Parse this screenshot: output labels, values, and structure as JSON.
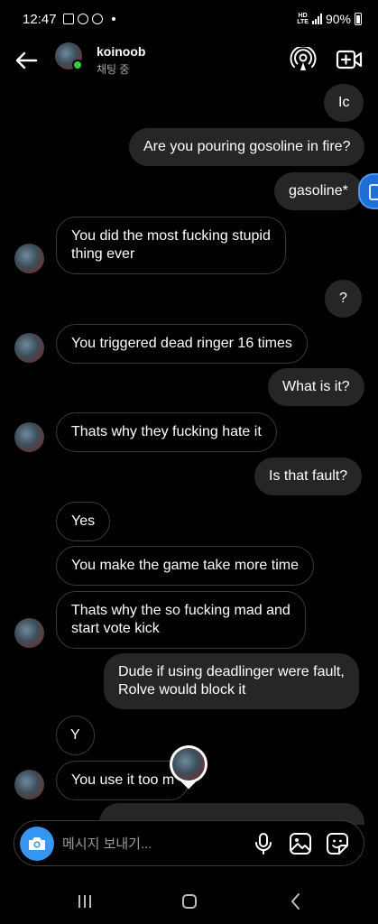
{
  "status_bar": {
    "time": "12:47",
    "network_top": "HD",
    "network_bottom": "LTE",
    "battery": "90%",
    "icons": [
      "gallery-icon",
      "instagram-icon",
      "app-icon",
      "dot"
    ]
  },
  "header": {
    "name": "koinoob",
    "status": "채팅 중",
    "icons": [
      "back-arrow-icon",
      "audio-call-icon",
      "video-call-icon"
    ],
    "online_color": "#2ecc40"
  },
  "messages": [
    {
      "side": "sent",
      "text": "Ic"
    },
    {
      "side": "sent",
      "text": "Are you pouring gosoline in fire?"
    },
    {
      "side": "sent",
      "text": "gasoline*"
    },
    {
      "side": "received",
      "text": "You did the most fucking stupid\nthing ever"
    },
    {
      "side": "sent",
      "text": "?"
    },
    {
      "side": "received",
      "text": "You triggered dead ringer 16 times"
    },
    {
      "side": "sent",
      "text": "What is it?"
    },
    {
      "side": "received",
      "text": "Thats why they fucking hate it"
    },
    {
      "side": "sent",
      "text": "Is that fault?"
    },
    {
      "side": "received",
      "text": "Yes"
    },
    {
      "side": "received",
      "text": "You make the game take more time"
    },
    {
      "side": "received",
      "text": "Thats why the so fucking mad and\nstart vote kick"
    },
    {
      "side": "sent",
      "text": "Dude if using deadlinger were fault,\nRolve would block it"
    },
    {
      "side": "received",
      "text": "Y"
    },
    {
      "side": "received",
      "text": "You use it too m"
    }
  ],
  "composer": {
    "placeholder": "메시지 보내기...",
    "icons": [
      "camera-icon",
      "microphone-icon",
      "gallery-icon",
      "sticker-icon"
    ],
    "camera_color": "#3796f0"
  },
  "nav_bar": {
    "icons": [
      "recents-icon",
      "home-icon",
      "back-icon"
    ]
  },
  "colors": {
    "sent_bubble": "#262626",
    "received_border": "#3a3a3a",
    "side_widget": "#1e6fd8"
  }
}
